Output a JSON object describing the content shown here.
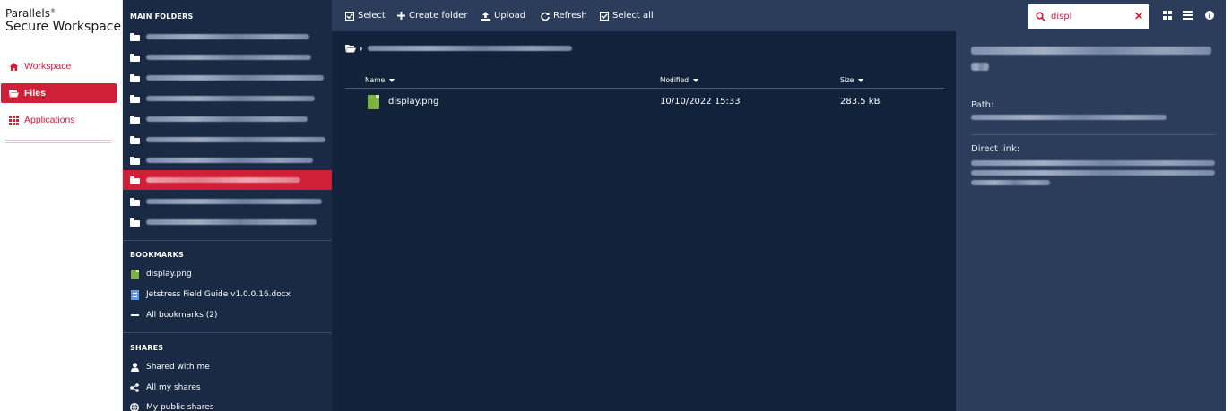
{
  "brand": {
    "line1": "Parallels",
    "line1_mark": "®",
    "line2": "Secure Workspace"
  },
  "appnav": {
    "items": [
      {
        "label": "Workspace",
        "icon": "home-icon",
        "active": false
      },
      {
        "label": "Files",
        "icon": "folder-open-icon",
        "active": true
      },
      {
        "label": "Applications",
        "icon": "apps-grid-icon",
        "active": false
      }
    ]
  },
  "sidebar": {
    "main_folders_title": "MAIN FOLDERS",
    "folders": [
      {
        "label_redacted": true,
        "active": false
      },
      {
        "label_redacted": true,
        "active": false
      },
      {
        "label_redacted": true,
        "active": false
      },
      {
        "label_redacted": true,
        "active": false
      },
      {
        "label_redacted": true,
        "active": false
      },
      {
        "label_redacted": true,
        "active": false
      },
      {
        "label_redacted": true,
        "active": false
      },
      {
        "label_redacted": true,
        "active": true
      },
      {
        "label_redacted": true,
        "active": false
      },
      {
        "label_redacted": true,
        "active": false
      }
    ],
    "bookmarks_title": "BOOKMARKS",
    "bookmarks": [
      {
        "label": "display.png",
        "icon": "image-file-icon"
      },
      {
        "label": "Jetstress Field Guide v1.0.0.16.docx",
        "icon": "doc-file-icon"
      },
      {
        "label": "All bookmarks (2)",
        "icon": "dash-icon"
      }
    ],
    "shares_title": "SHARES",
    "shares": [
      {
        "label": "Shared with me",
        "icon": "user-icon"
      },
      {
        "label": "All my shares",
        "icon": "share-icon"
      },
      {
        "label": "My public shares",
        "icon": "globe-icon"
      }
    ]
  },
  "toolbar": {
    "select": "Select",
    "create_folder": "Create folder",
    "upload": "Upload",
    "refresh": "Refresh",
    "select_all": "Select all"
  },
  "search": {
    "value": "displ",
    "placeholder": ""
  },
  "main": {
    "breadcrumb_sep": "›",
    "columns": {
      "name": "Name",
      "modified": "Modified",
      "size": "Size"
    },
    "files": [
      {
        "name": "display.png",
        "modified": "10/10/2022 15:33",
        "size": "283.5 kB",
        "icon": "image-file-icon"
      }
    ]
  },
  "details": {
    "path_label": "Path:",
    "direct_link_label": "Direct link:"
  },
  "colors": {
    "accent": "#cf2037",
    "sidebar_bg": "#1a2a44",
    "main_bg": "#12223b",
    "toolbar_bg": "#2b3d5b"
  }
}
